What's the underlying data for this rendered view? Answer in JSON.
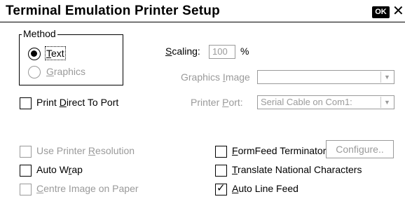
{
  "window": {
    "title": "Terminal Emulation Printer Setup",
    "ok_label": "OK",
    "close_glyph": "✕"
  },
  "method": {
    "group_label": "Method",
    "text": {
      "pre": "",
      "key": "T",
      "post": "ext",
      "selected": true
    },
    "graphics": {
      "pre": "",
      "key": "G",
      "post": "raphics",
      "selected": false
    }
  },
  "print_direct": {
    "pre": "Print ",
    "key": "D",
    "post": "irect To Port",
    "checked": false
  },
  "scaling": {
    "pre": "",
    "key": "S",
    "post": "caling:",
    "value": "100",
    "unit": "%"
  },
  "graphics_image": {
    "pre": "Graphics ",
    "key": "I",
    "post": "mage",
    "value": ""
  },
  "printer_port": {
    "pre": "Printer ",
    "key": "P",
    "post": "ort:",
    "value": "Serial Cable on Com1:"
  },
  "configure": {
    "pre": "Confi",
    "key": "g",
    "post": "ure.."
  },
  "checkboxes": {
    "use_printer_resolution": {
      "pre": "Use Printer ",
      "key": "R",
      "post": "esolution",
      "checked": false
    },
    "auto_wrap": {
      "pre": "Auto W",
      "key": "r",
      "post": "ap",
      "checked": false
    },
    "centre_image": {
      "pre": "",
      "key": "C",
      "post": "entre Image on Paper",
      "checked": false
    },
    "formfeed_terminator": {
      "pre": "",
      "key": "F",
      "post": "ormFeed Terminator",
      "checked": false
    },
    "translate_national": {
      "pre": "",
      "key": "T",
      "post": "ranslate National Characters",
      "checked": false
    },
    "auto_line_feed": {
      "pre": "",
      "key": "A",
      "post": "uto Line Feed",
      "checked": true
    }
  },
  "icons": {
    "dropdown": "triangle-down",
    "checkmark": "✓"
  },
  "colors": {
    "disabled": "#9a9a9a",
    "text": "#000000",
    "background": "#ffffff"
  }
}
